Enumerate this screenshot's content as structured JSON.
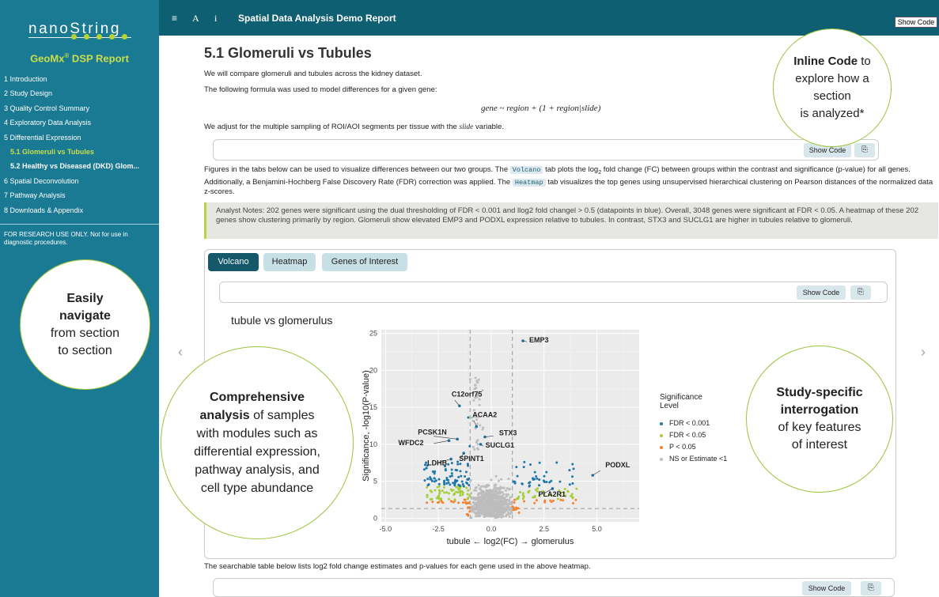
{
  "sidebar": {
    "logo": "nanoString",
    "report_title": "GeoMx",
    "report_title_sup": "®",
    "report_title_rest": " DSP Report",
    "nav": [
      {
        "label": "1 Introduction"
      },
      {
        "label": "2 Study Design"
      },
      {
        "label": "3 Quality Control Summary"
      },
      {
        "label": "4 Exploratory Data Analysis"
      },
      {
        "label": "5 Differential Expression"
      },
      {
        "label": "5.1 Glomeruli vs Tubules"
      },
      {
        "label": "5.2 Healthy vs Diseased (DKD) Glom..."
      },
      {
        "label": "6 Spatial Deconvolution"
      },
      {
        "label": "7 Pathway Analysis"
      },
      {
        "label": "8 Downloads & Appendix"
      }
    ],
    "disclaimer": "FOR RESEARCH USE ONLY. Not for use in diagnostic procedures."
  },
  "topbar": {
    "menu_icon": "≡",
    "font_icon": "A",
    "info_icon": "i",
    "title": "Spatial Data Analysis Demo Report",
    "show_code": "Show Code"
  },
  "content": {
    "section_title": "5.1  Glomeruli vs Tubules",
    "p1": "We will compare glomeruli and tubules across the kidney dataset.",
    "p2": "The following formula was used to model differences for a given gene:",
    "formula": "gene ~ region + (1 + region|slide)",
    "p3_pre": "We adjust for the multiple sampling of ROI/AOI segments per tissue with the ",
    "p3_var": "slide",
    "p3_post": " variable.",
    "show_code": "Show Code",
    "copy_icon": "⎘",
    "fig_desc_1": "Figures in the tabs below can be used to visualize differences between our two groups. The ",
    "fig_desc_code1": "Volcano",
    "fig_desc_2": " tab plots the log",
    "fig_desc_sub": "2",
    "fig_desc_3": " fold change (FC) between groups within the contrast and significance (p-value) for all genes. Additionally, a Benjamini-Hochberg False Discovery Rate (FDR) correction was applied. The ",
    "fig_desc_code2": "Heatmap",
    "fig_desc_4": " tab visualizes the top genes using unsupervised hierarchical clustering on Pearson distances of the normalized data z-scores.",
    "notes": "Analyst Notes: 202 genes were significant using the dual thresholding of FDR < 0.001 and llog2 fold changel > 0.5 (datapoints in blue). Overall, 3048 genes were significant at FDR < 0.05. A heatmap of these 202 genes show clustering primarily by region. Glomeruli show elevated EMP3 and PODXL expression relative to tubules. In contrast, STX3 and SUCLG1 are higher in tubules relative to glomeruli.",
    "tabs": [
      {
        "label": "Volcano"
      },
      {
        "label": "Heatmap"
      },
      {
        "label": "Genes of Interest"
      }
    ],
    "bottom_desc": "The searchable table below lists log2 fold change estimates and p-values for each gene used in the above heatmap.",
    "nav_prev": "‹",
    "nav_next": "›"
  },
  "chart_data": {
    "type": "scatter",
    "title": "tubule vs glomerulus",
    "xlabel": "tubule ← log2(FC) → glomerulus",
    "ylabel": "Significance, -log10(P-value)",
    "xlim": [
      -5.2,
      7.0
    ],
    "ylim": [
      -0.5,
      25.5
    ],
    "xticks": [
      "-5.0",
      "-2.5",
      "0.0",
      "2.5",
      "5.0"
    ],
    "yticks": [
      "0",
      "5",
      "10",
      "15",
      "20",
      "25"
    ],
    "xtick_values": [
      -5,
      -2.5,
      0,
      2.5,
      5
    ],
    "ytick_values": [
      0,
      5,
      10,
      15,
      20,
      25
    ],
    "thresholds": {
      "x": [
        -1,
        1
      ],
      "y": 1.3
    },
    "grid": true,
    "legend": {
      "title_line1": "Significance",
      "title_line2": "Level",
      "position": "right",
      "items": [
        {
          "label": "FDR < 0.001",
          "color": "#1f77a8"
        },
        {
          "label": "FDR < 0.05",
          "color": "#a6ce39"
        },
        {
          "label": "P < 0.05",
          "color": "#f58231"
        },
        {
          "label": "NS or Estimate <1",
          "color": "#bdbdbd"
        }
      ]
    },
    "labeled_genes": [
      {
        "gene": "EMP3",
        "x": 1.5,
        "y": 24.0
      },
      {
        "gene": "C12orf75",
        "x": -1.5,
        "y": 15.2
      },
      {
        "gene": "ACAA2",
        "x": -0.7,
        "y": 12.4
      },
      {
        "gene": "STX3",
        "x": -0.3,
        "y": 11.0
      },
      {
        "gene": "PCSK1N",
        "x": -1.6,
        "y": 10.7
      },
      {
        "gene": "SUCLG1",
        "x": -0.5,
        "y": 10.0
      },
      {
        "gene": "WFDC2",
        "x": -2.0,
        "y": 10.5
      },
      {
        "gene": "SPINT1",
        "x": -1.3,
        "y": 8.8
      },
      {
        "gene": "LDHB",
        "x": -1.9,
        "y": 8.0
      },
      {
        "gene": "PODXL",
        "x": 4.8,
        "y": 5.8
      },
      {
        "gene": "PLA2R1",
        "x": 2.9,
        "y": 4.0
      }
    ]
  },
  "callouts": {
    "inline_code": {
      "bold": "Inline Code",
      "rest1": " to",
      "rest2": "explore how a",
      "rest3": "section",
      "rest4": "is analyzed*"
    },
    "navigate": {
      "bold1": "Easily",
      "bold2": "navigate",
      "rest1": "from section",
      "rest2": "to section"
    },
    "comprehensive": {
      "bold1": "Comprehensive",
      "bold2": "analysis",
      "rest1": " of samples",
      "rest2": "with modules such as",
      "rest3": "differential expression,",
      "rest4": "pathway analysis, and",
      "rest5": "cell type abundance"
    },
    "study_specific": {
      "bold1": "Study-specific",
      "bold2": "interrogation",
      "rest1": "of key features",
      "rest2": "of interest"
    }
  }
}
